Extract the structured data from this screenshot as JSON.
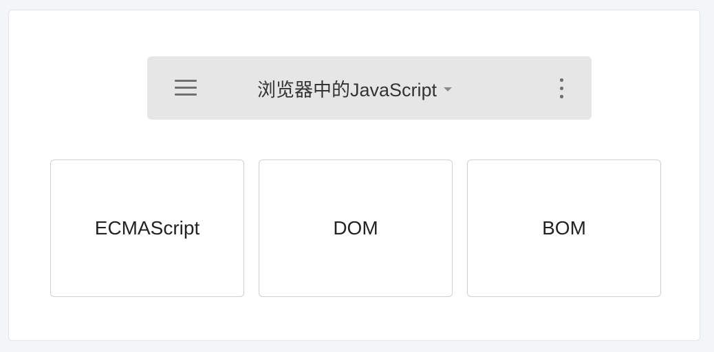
{
  "toolbar": {
    "title": "浏览器中的JavaScript",
    "menu_icon": "hamburger-menu-icon",
    "dropdown_icon": "caret-down-icon",
    "more_icon": "vertical-ellipsis-icon"
  },
  "boxes": [
    {
      "label": "ECMAScript"
    },
    {
      "label": "DOM"
    },
    {
      "label": "BOM"
    }
  ],
  "colors": {
    "toolbar_bg": "#e6e6e6",
    "card_bg": "#ffffff",
    "page_bg": "#f4f5f7",
    "text": "#222222",
    "box_border": "#cfcfcf"
  }
}
